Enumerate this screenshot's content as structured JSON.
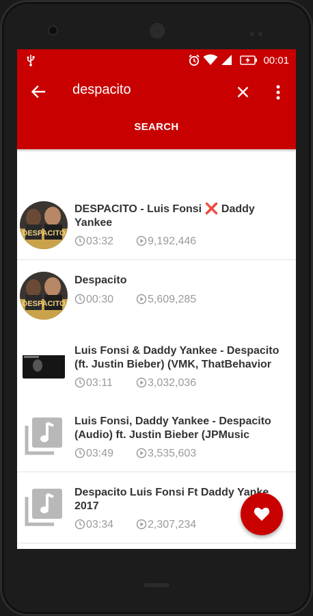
{
  "status_bar": {
    "time": "00:01",
    "icons": [
      "usb-icon",
      "alarm-icon",
      "wifi-icon",
      "signal-icon",
      "battery-charging-icon"
    ]
  },
  "toolbar": {
    "query": "despacito",
    "back_icon": "arrow-back-icon",
    "clear_icon": "close-icon",
    "menu_icon": "more-vert-icon",
    "search_label": "SEARCH"
  },
  "results": [
    {
      "title": "DESPACITO - Luis Fonsi ❌ Daddy Yankee",
      "duration": "03:32",
      "views": "9,192,446",
      "thumb": "album-art"
    },
    {
      "title": "Despacito",
      "duration": "00:30",
      "views": "5,609,285",
      "thumb": "album-art"
    },
    {
      "title": "Luis Fonsi & Daddy Yankee - Despacito (ft. Justin Bieber) (VMK, ThatBehavior",
      "duration": "03:11",
      "views": "3,032,036",
      "thumb": "video-still"
    },
    {
      "title": "Luis Fonsi, Daddy Yankee - Despacito (Audio) ft. Justin Bieber (JPMusic",
      "duration": "03:49",
      "views": "3,535,603",
      "thumb": "music-library-icon"
    },
    {
      "title": "Despacito Luis Fonsi Ft Daddy Yanke 2017",
      "duration": "03:34",
      "views": "2,307,234",
      "thumb": "music-library-icon"
    }
  ],
  "fab": {
    "icon": "heart-icon"
  },
  "colors": {
    "primary": "#c90000",
    "text": "#333333",
    "meta": "#9a9a9a"
  }
}
